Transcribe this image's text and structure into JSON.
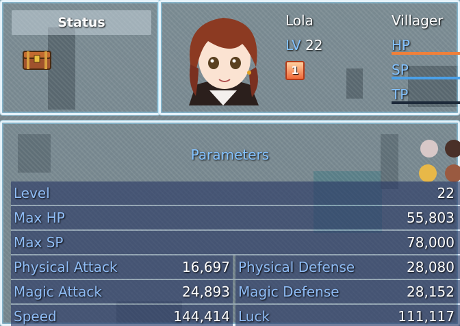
{
  "command_window": {
    "selected_command": "Status"
  },
  "actor": {
    "name": "Lola",
    "class": "Villager",
    "level_label": "LV",
    "level": "22",
    "state_icon_text": "1",
    "gauges": [
      {
        "label": "HP",
        "fill": 1.0,
        "color": "#f0803a"
      },
      {
        "label": "SP",
        "fill": 1.0,
        "color": "#4aa0e8"
      },
      {
        "label": "TP",
        "fill": 0.0,
        "color": "#60c060"
      }
    ]
  },
  "parameters": {
    "title": "Parameters",
    "rows": [
      {
        "label": "Level",
        "value": "22"
      },
      {
        "label": "Max HP",
        "value": "55,803"
      },
      {
        "label": "Max SP",
        "value": "78,000"
      }
    ],
    "pairs": [
      {
        "left_label": "Physical Attack",
        "left_value": "16,697",
        "right_label": "Physical Defense",
        "right_value": "28,080"
      },
      {
        "left_label": "Magic Attack",
        "left_value": "24,893",
        "right_label": "Magic Defense",
        "right_value": "28,152"
      },
      {
        "left_label": "Speed",
        "left_value": "144,414",
        "right_label": "Luck",
        "right_value": "111,117"
      }
    ]
  }
}
